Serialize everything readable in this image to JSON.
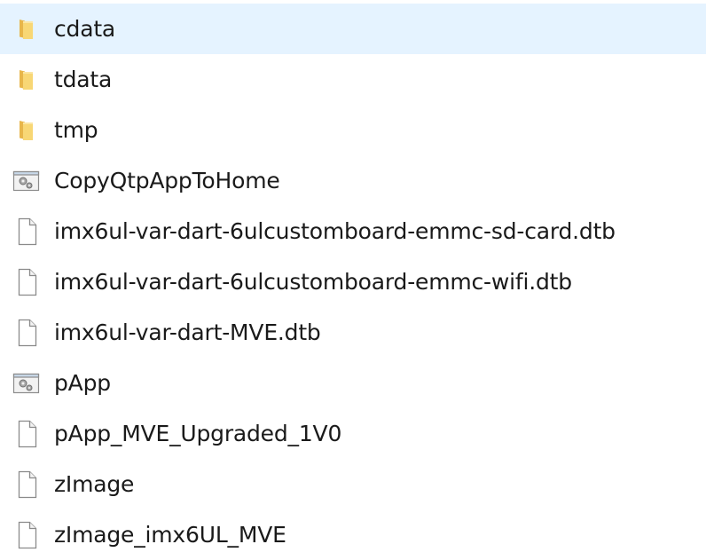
{
  "files": [
    {
      "name": "cdata",
      "type": "folder",
      "selected": true
    },
    {
      "name": "tdata",
      "type": "folder",
      "selected": false
    },
    {
      "name": "tmp",
      "type": "folder",
      "selected": false
    },
    {
      "name": "CopyQtpAppToHome",
      "type": "application",
      "selected": false
    },
    {
      "name": "imx6ul-var-dart-6ulcustomboard-emmc-sd-card.dtb",
      "type": "file",
      "selected": false
    },
    {
      "name": "imx6ul-var-dart-6ulcustomboard-emmc-wifi.dtb",
      "type": "file",
      "selected": false
    },
    {
      "name": "imx6ul-var-dart-MVE.dtb",
      "type": "file",
      "selected": false
    },
    {
      "name": "pApp",
      "type": "application",
      "selected": false
    },
    {
      "name": "pApp_MVE_Upgraded_1V0",
      "type": "file",
      "selected": false
    },
    {
      "name": "zImage",
      "type": "file",
      "selected": false
    },
    {
      "name": "zImage_imx6UL_MVE",
      "type": "file",
      "selected": false
    }
  ],
  "icons": {
    "folder": "folder-icon",
    "application": "application-icon",
    "file": "file-icon"
  },
  "colors": {
    "selection": "#e5f3ff",
    "folder": "#f8d775",
    "text": "#1a1a1a"
  }
}
